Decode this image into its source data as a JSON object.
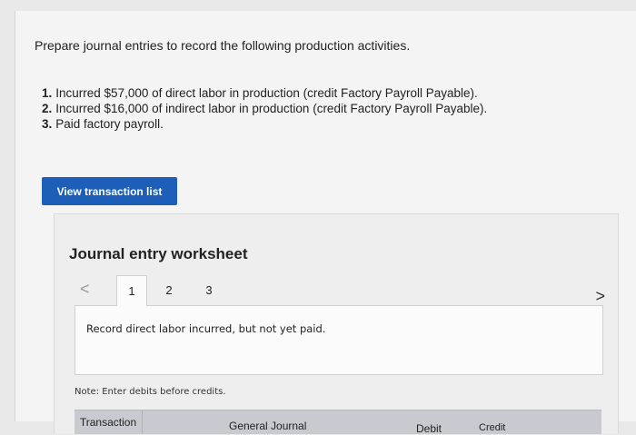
{
  "prompt": "Prepare journal entries to record the following production activities.",
  "steps": [
    {
      "num": "1.",
      "text": "Incurred $57,000 of direct labor in production (credit Factory Payroll Payable)."
    },
    {
      "num": "2.",
      "text": "Incurred $16,000 of indirect labor in production (credit Factory Payroll Payable)."
    },
    {
      "num": "3.",
      "text": "Paid factory payroll."
    }
  ],
  "view_button": "View transaction list",
  "worksheet": {
    "title": "Journal entry worksheet",
    "prev_glyph": "<",
    "next_glyph": ">",
    "tabs": [
      "1",
      "2",
      "3"
    ],
    "instruction": "Record direct labor incurred, but not yet paid.",
    "note": "Note: Enter debits before credits.",
    "columns": [
      "Transaction",
      "General Journal",
      "Debit",
      "Credit"
    ]
  },
  "icons": {
    "prev": "chevron-left-icon",
    "next": "chevron-right-icon"
  }
}
